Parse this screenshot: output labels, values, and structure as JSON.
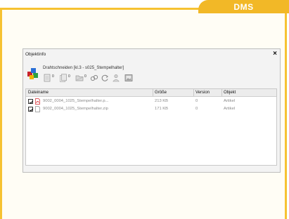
{
  "badge": {
    "label": "DMS"
  },
  "window": {
    "title": "Objektinfo",
    "close_glyph": "×"
  },
  "object": {
    "title": "Drahtschneiden [kl.3 - s025_Stempelhalter]",
    "icon": "multi-colored-objects-icon"
  },
  "toolbar": {
    "items": [
      {
        "icon": "document-icon",
        "count": "0"
      },
      {
        "icon": "document-copy-icon",
        "count": "0"
      },
      {
        "icon": "folder-icon",
        "count": "0"
      },
      {
        "icon": "link-icon",
        "count": ""
      },
      {
        "icon": "refresh-icon",
        "count": ""
      },
      {
        "icon": "user-icon",
        "count": ""
      },
      {
        "icon": "image-icon",
        "count": ""
      }
    ]
  },
  "table": {
    "columns": [
      "Dateiname",
      "Größe",
      "Version",
      "Objekt"
    ],
    "rows": [
      {
        "filename": "9002_0004_1025_Stempelhalter.p...",
        "size": "213 KB",
        "version": "0",
        "object": "Artikel",
        "file_icon": "pdf-icon"
      },
      {
        "filename": "9002_0004_1025_Stempelhalter.zip",
        "size": "171 KB",
        "version": "0",
        "object": "Artikel",
        "file_icon": "file-icon"
      }
    ]
  },
  "colors": {
    "accent": "#f2b827",
    "frame": "#f6c232",
    "pdf_red": "#d2232a"
  }
}
